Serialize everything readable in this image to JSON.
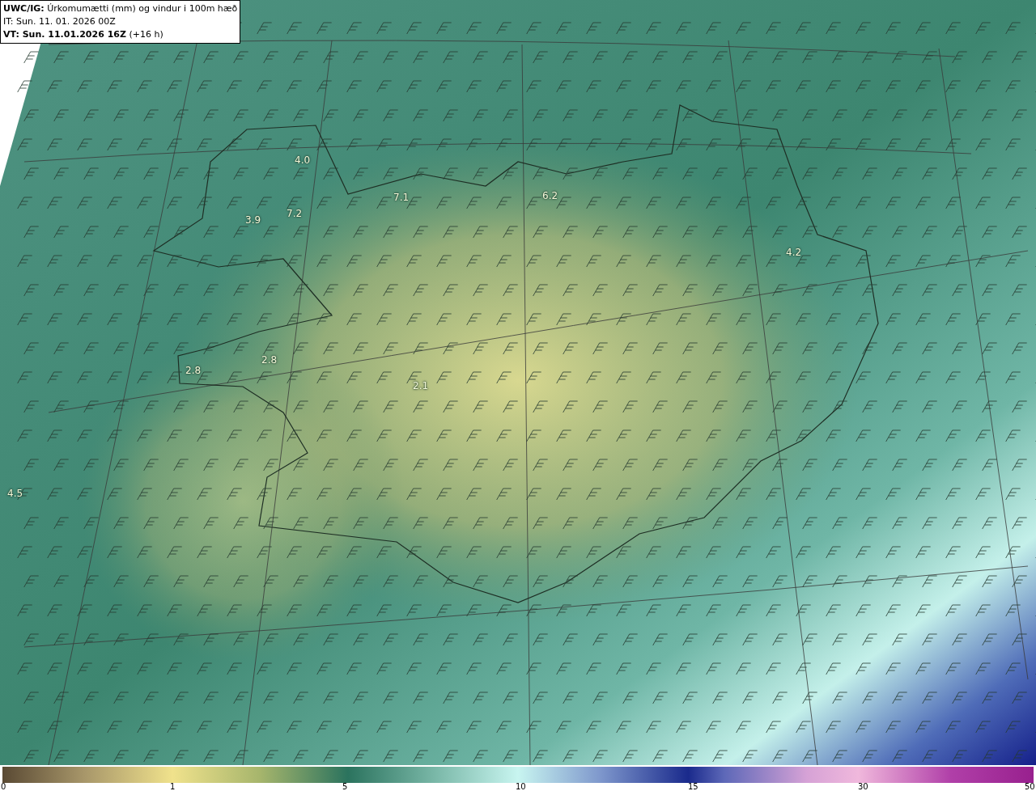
{
  "header": {
    "title": "**UWC/IG:** Úrkomumætti (mm) og vindur i 100m hæð",
    "init_time": "IT: Sun. 11. 01. 2026 00Z",
    "valid_time": "**VT: Sun. 11.01.2026 16Z** (+16 h)"
  },
  "map_values": [
    "4.0",
    "7.1",
    "6.2",
    "7.2",
    "3.9",
    "4.2",
    "2.8",
    "2.8",
    "2.1",
    "4.5"
  ],
  "colorbar": {
    "ticks": [
      "0",
      "1",
      "5",
      "10",
      "15",
      "30",
      "50"
    ]
  }
}
